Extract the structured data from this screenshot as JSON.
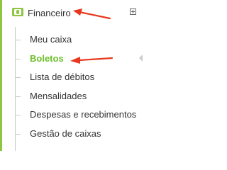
{
  "colors": {
    "accent": "#8dc63f",
    "active_text": "#6cbf2a",
    "annotation_arrow": "#e8371e",
    "text": "#333333"
  },
  "header": {
    "icon": "money-icon",
    "label": "Financeiro",
    "expand_icon": "expand-plus-icon"
  },
  "submenu": {
    "items": [
      {
        "label": "Meu caixa",
        "active": false
      },
      {
        "label": "Boletos",
        "active": true
      },
      {
        "label": "Lista de débitos",
        "active": false
      },
      {
        "label": "Mensalidades",
        "active": false
      },
      {
        "label": "Despesas e recebimentos",
        "active": false
      },
      {
        "label": "Gestão de caixas",
        "active": false
      }
    ]
  },
  "annotations": {
    "arrows": [
      "arrow-pointing-financeiro",
      "arrow-pointing-boletos"
    ]
  }
}
